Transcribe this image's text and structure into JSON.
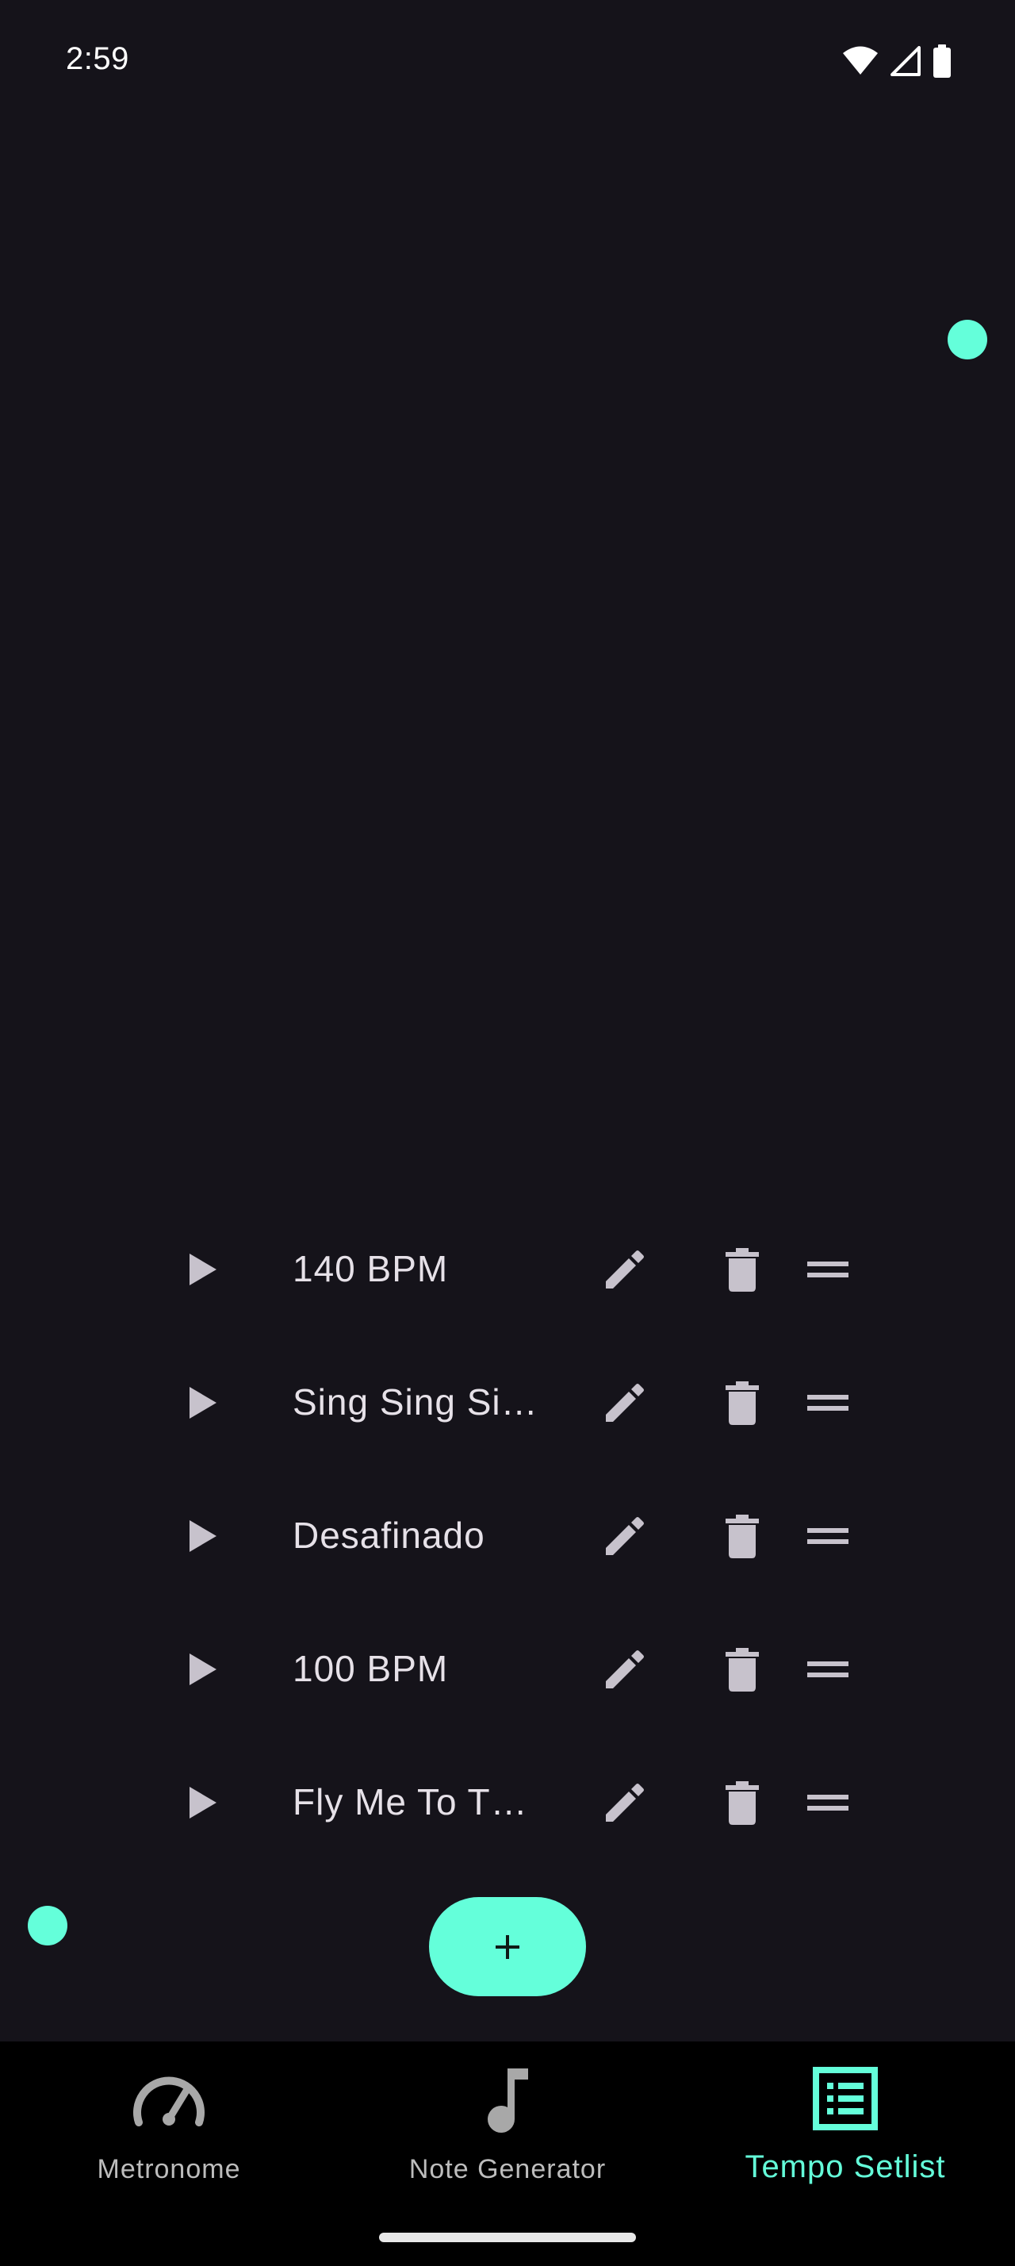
{
  "status_bar": {
    "time": "2:59",
    "icons": [
      "wifi-icon",
      "signal-icon",
      "battery-icon"
    ]
  },
  "setlist": {
    "items": [
      {
        "title": "140 BPM"
      },
      {
        "title": "Sing Sing Si…"
      },
      {
        "title": "Desafinado"
      },
      {
        "title": "100 BPM"
      },
      {
        "title": "Fly Me To T…"
      }
    ]
  },
  "fab": {
    "label": "+"
  },
  "bottom_nav": {
    "items": [
      {
        "label": "Metronome",
        "icon": "speedometer-icon",
        "active": false
      },
      {
        "label": "Note Generator",
        "icon": "music-note-icon",
        "active": false
      },
      {
        "label": "Tempo Setlist",
        "icon": "list-icon",
        "active": true
      }
    ]
  },
  "colors": {
    "accent": "#64ffda",
    "background": "#15131a",
    "nav_background": "#000000",
    "icon_muted": "#c7c2cc"
  }
}
